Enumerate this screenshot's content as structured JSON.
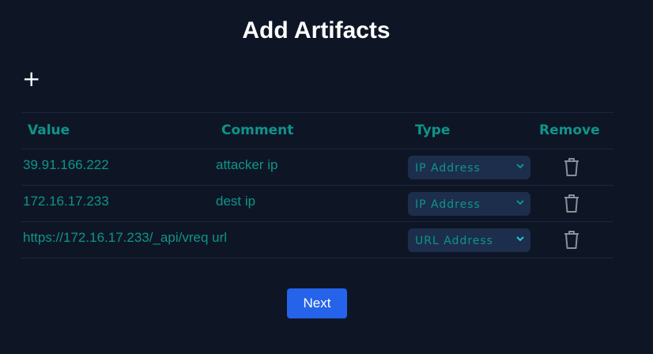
{
  "title": "Add Artifacts",
  "add_icon": "plus-icon",
  "headers": {
    "value": "Value",
    "comment": "Comment",
    "type": "Type",
    "remove": "Remove"
  },
  "rows": [
    {
      "value": "39.91.166.222",
      "comment": "attacker ip",
      "type": "IP Address"
    },
    {
      "value": "172.16.17.233",
      "comment": "dest ip",
      "type": "IP Address"
    },
    {
      "value": "https://172.16.17.233/_api/vreq url",
      "comment": "",
      "type": "URL Address"
    }
  ],
  "next_label": "Next",
  "colors": {
    "background": "#0e1626",
    "accent": "#0f9488",
    "button": "#2563eb",
    "select": "#1c2e4b"
  }
}
